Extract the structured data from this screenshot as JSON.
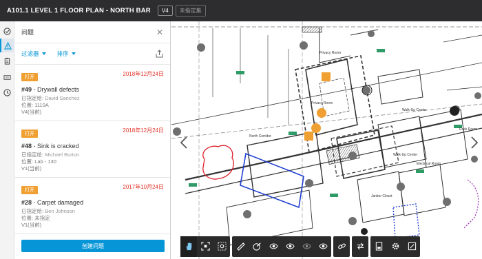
{
  "header": {
    "title": "A101.1 LEVEL 1 FLOOR PLAN - NORTH BAR",
    "version": "V4",
    "set_label": "未指定集"
  },
  "rail": {
    "items": [
      "check-icon",
      "warning-icon",
      "clipboard-icon",
      "rfi-icon",
      "clock-icon"
    ]
  },
  "panel": {
    "title": "问题",
    "filter_label": "过滤器",
    "sort_label": "排序",
    "create_label": "创建问题"
  },
  "issues": [
    {
      "status": "打开",
      "date": "2018年12月24日",
      "number": "#49",
      "title": "Drywall defects",
      "assigned_label": "已指定给:",
      "assigned": "David Sanchez",
      "location_label": "位置:",
      "location": "1110A",
      "version": "V4(当前)"
    },
    {
      "status": "打开",
      "date": "2018年12月24日",
      "number": "#48",
      "title": "Sink is cracked",
      "assigned_label": "已指定给:",
      "assigned": "Michael Burton",
      "location_label": "位置:",
      "location": "Lab - 130",
      "version": "V1(当前)"
    },
    {
      "status": "打开",
      "date": "2017年10月24日",
      "number": "#28",
      "title": "Carpet damaged",
      "assigned_label": "已指定给:",
      "assigned": "Ben Johnson",
      "location_label": "位置:",
      "location": "未指定",
      "version": "V1(当前)"
    }
  ],
  "drawing_labels": {
    "privacy_room": "Privacy Room",
    "walk_up_center": "Walk-Up Center",
    "north_corridor": "North Corridor",
    "electrical_room": "Electrical Room",
    "janitor_closet": "Janitor Closet",
    "rack_room": "Rack Room"
  },
  "colors": {
    "accent": "#0696d7",
    "status_open": "#f0a032",
    "date_red": "#e3342b",
    "topbar": "#2d2d2f"
  }
}
